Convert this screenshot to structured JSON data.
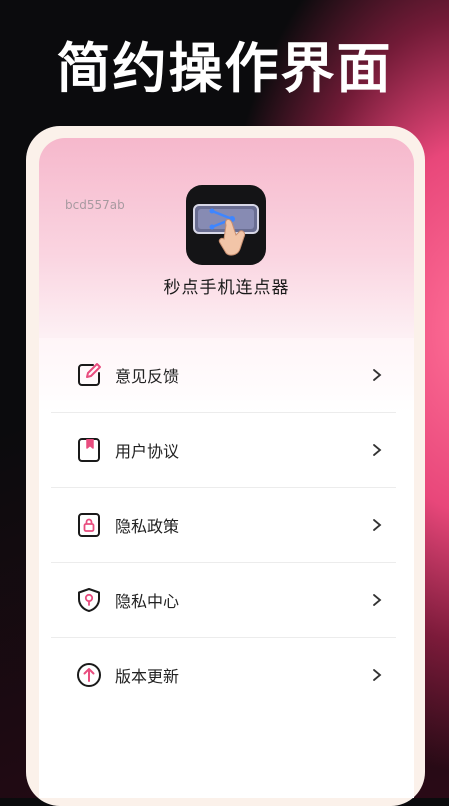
{
  "promo": {
    "headline": "简约操作界面"
  },
  "profile": {
    "user_id": "bcd557ab",
    "app_name": "秒点手机连点器",
    "app_icon": "tap-gesture-icon"
  },
  "menu": {
    "items": [
      {
        "label": "意见反馈",
        "icon": "edit-icon"
      },
      {
        "label": "用户协议",
        "icon": "bookmark-doc-icon"
      },
      {
        "label": "隐私政策",
        "icon": "lock-icon"
      },
      {
        "label": "隐私中心",
        "icon": "shield-pin-icon"
      },
      {
        "label": "版本更新",
        "icon": "upload-arrow-icon"
      }
    ],
    "chevron": "chevron-right-icon"
  },
  "colors": {
    "accent": "#e84d7f",
    "icon_stroke": "#1a1a1a",
    "headline": "#ffffff"
  }
}
